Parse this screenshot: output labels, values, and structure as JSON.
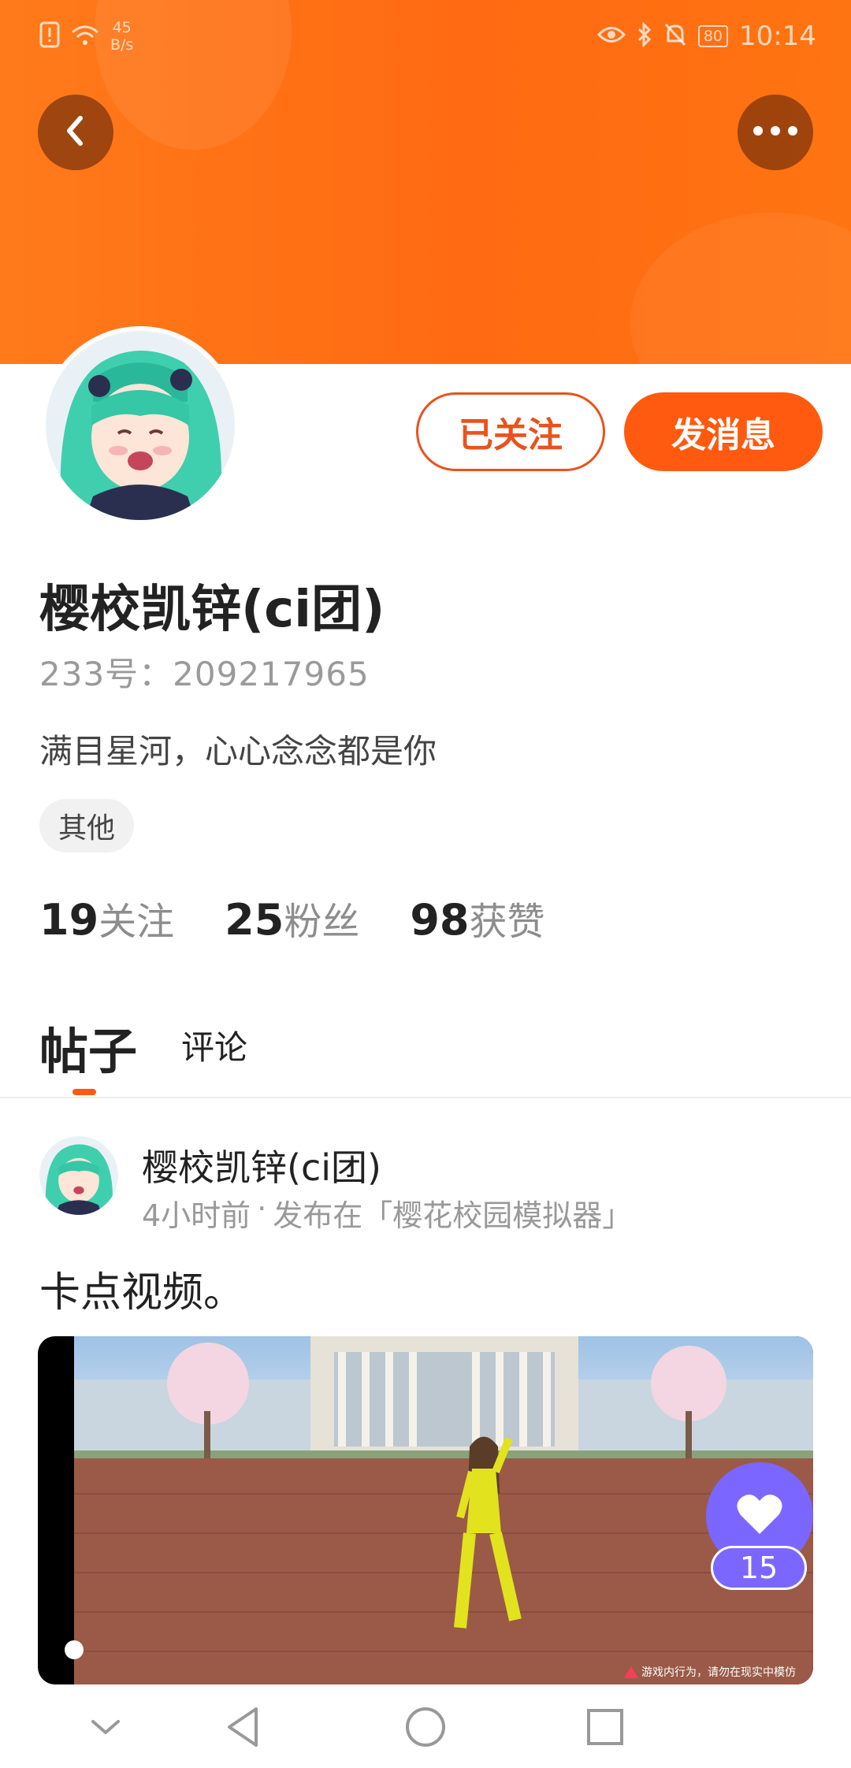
{
  "status_bar": {
    "net_speed_value": "45",
    "net_speed_unit": "B/s",
    "battery": "80",
    "time": "10:14",
    "icons": [
      "warning-icon",
      "wifi-icon",
      "eye-icon",
      "bluetooth-icon",
      "mute-icon",
      "battery-icon"
    ]
  },
  "header": {
    "accent_color": "#ff6a12",
    "back_icon": "chevron-left-icon",
    "more_icon": "more-icon"
  },
  "profile": {
    "follow_label": "已关注",
    "message_label": "发消息",
    "name": "樱校凯锌(ci团)",
    "id_text": "233号：209217965",
    "bio": "满目星河，心心念念都是你",
    "tag": "其他",
    "stats": [
      {
        "num": "19",
        "label": "关注"
      },
      {
        "num": "25",
        "label": "粉丝"
      },
      {
        "num": "98",
        "label": "获赞"
      }
    ]
  },
  "tabs": [
    {
      "label": "帖子",
      "active": true
    },
    {
      "label": "评论",
      "active": false
    }
  ],
  "post": {
    "author": "樱校凯锌(ci团)",
    "time": "4小时前",
    "separator": "·",
    "published_in": "发布在「樱花校园模拟器」",
    "text": "卡点视频。",
    "watermark": "游戏内行为，请勿在现实中模仿",
    "like_count": "15",
    "like_color": "#7b67ff"
  },
  "nav": {
    "icons": [
      "collapse-icon",
      "back-icon",
      "home-icon",
      "recents-icon"
    ]
  }
}
